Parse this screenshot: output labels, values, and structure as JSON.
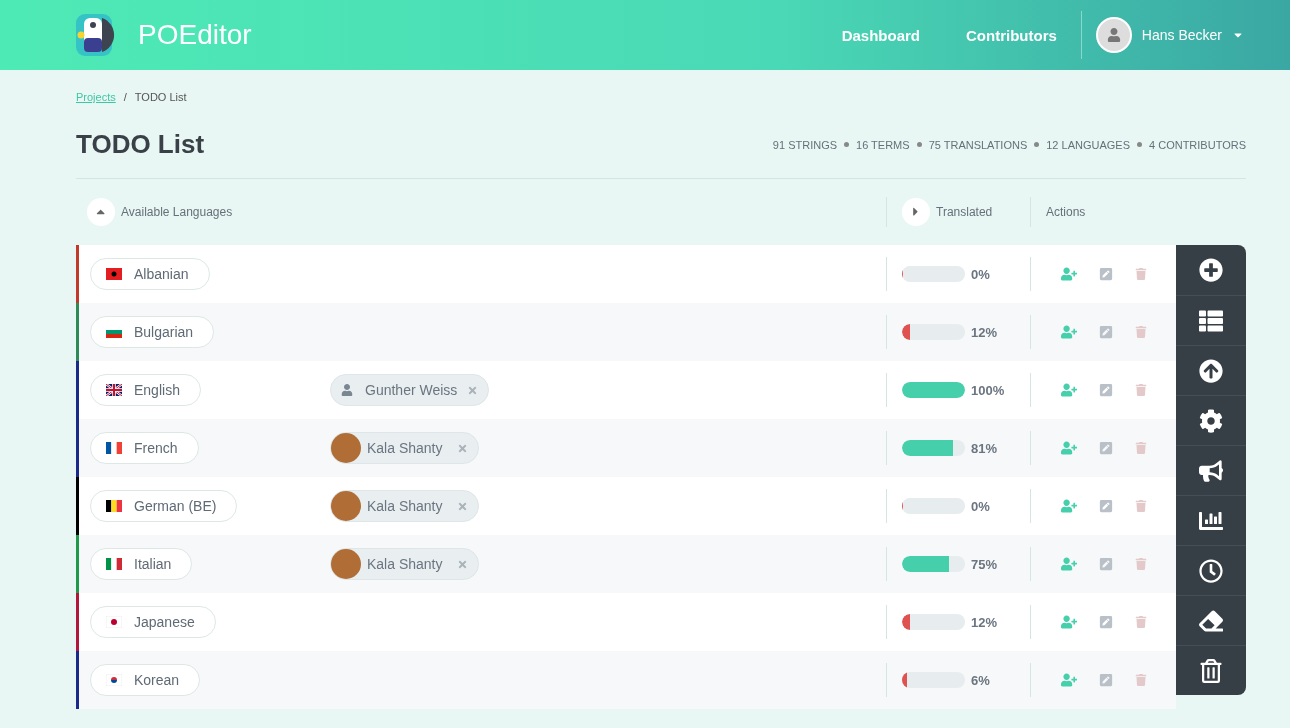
{
  "header": {
    "logo": {
      "light": "PO",
      "bold": "Editor"
    },
    "nav": [
      "Dashboard",
      "Contributors"
    ],
    "user": {
      "name": "Hans Becker"
    }
  },
  "breadcrumb": {
    "link": "Projects",
    "separator": "/",
    "current": "TODO List"
  },
  "project": {
    "title": "TODO List",
    "stats": [
      "91 STRINGS",
      "16 TERMS",
      "75 TRANSLATIONS",
      "12 LANGUAGES",
      "4 CONTRIBUTORS"
    ]
  },
  "table": {
    "columns": [
      "Available Languages",
      "Translated",
      "Actions"
    ],
    "rows": [
      {
        "language": "Albanian",
        "kind": "al",
        "color": "#c0392b",
        "contributors": [],
        "level": 0,
        "percent": "0%"
      },
      {
        "language": "Bulgarian",
        "kind": "bg",
        "color": "#2e8b57",
        "contributors": [],
        "level": 0.12,
        "percent": "12%"
      },
      {
        "language": "English",
        "kind": "gb",
        "color": "#1a2a8a",
        "contributors": [
          {
            "name": "Gunther Weiss",
            "kind": "user"
          }
        ],
        "level": 1,
        "percent": "100%"
      },
      {
        "language": "French",
        "kind": "fr",
        "color": "#1a2a8a",
        "contributors": [
          {
            "name": "Kala Shanty",
            "kind": "photo"
          }
        ],
        "level": 0.81,
        "percent": "81%"
      },
      {
        "language": "German (BE)",
        "kind": "be",
        "color": "#000000",
        "contributors": [
          {
            "name": "Kala Shanty",
            "kind": "photo"
          }
        ],
        "level": 0,
        "percent": "0%"
      },
      {
        "language": "Italian",
        "kind": "it",
        "color": "#1e9a4a",
        "contributors": [
          {
            "name": "Kala Shanty",
            "kind": "photo"
          }
        ],
        "level": 0.75,
        "percent": "75%"
      },
      {
        "language": "Japanese",
        "kind": "jp",
        "color": "#b0173a",
        "contributors": [],
        "level": 0.12,
        "percent": "12%"
      },
      {
        "language": "Korean",
        "kind": "kr",
        "color": "#1a2a8a",
        "contributors": [],
        "level": 0.06,
        "percent": "6%"
      }
    ]
  },
  "toolbar": [
    {
      "kind": "add"
    },
    {
      "kind": "list"
    },
    {
      "kind": "upload"
    },
    {
      "kind": "settings"
    },
    {
      "kind": "announce"
    },
    {
      "kind": "stats"
    },
    {
      "kind": "history"
    },
    {
      "kind": "clear"
    },
    {
      "kind": "delete"
    }
  ]
}
